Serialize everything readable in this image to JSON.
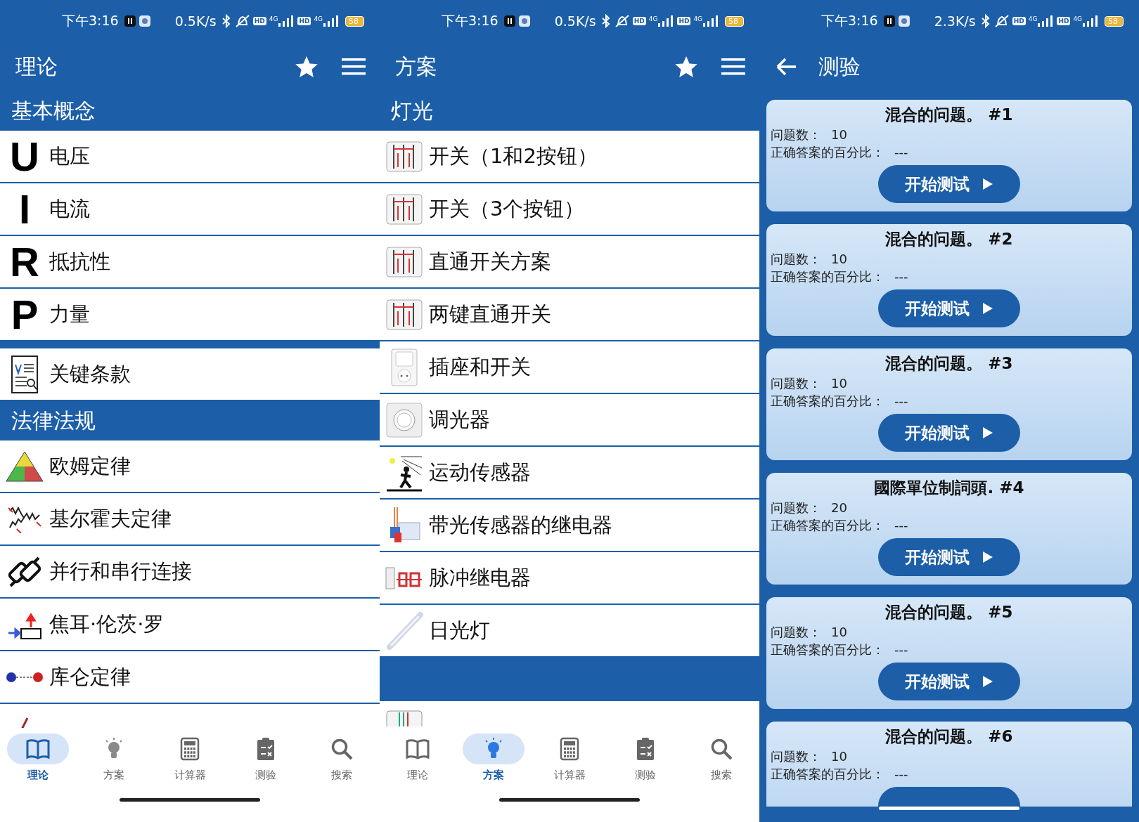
{
  "panels": [
    {
      "status_bar": {
        "time": "下午3:16",
        "speed": "0.5K/s",
        "badges": [
          "HD",
          "4G",
          "HD",
          "4G"
        ],
        "battery": "58"
      },
      "app_bar": {
        "title": "理论",
        "back": false,
        "actions": true
      },
      "sections": [
        {
          "title": "基本概念",
          "items": [
            {
              "kind": "letter",
              "symbol": "U",
              "label": "电压"
            },
            {
              "kind": "letter",
              "symbol": "I",
              "label": "电流"
            },
            {
              "kind": "letter",
              "symbol": "R",
              "label": "抵抗性"
            },
            {
              "kind": "letter",
              "symbol": "P",
              "label": "力量"
            }
          ]
        },
        {
          "items": [
            {
              "kind": "icon",
              "label": "关键条款"
            }
          ]
        },
        {
          "title": "法律法规",
          "items": [
            {
              "kind": "icon",
              "label": "欧姆定律"
            },
            {
              "kind": "icon",
              "label": "基尔霍夫定律"
            },
            {
              "kind": "icon",
              "label": "并行和串行连接"
            },
            {
              "kind": "icon",
              "label": "焦耳·伦茨·罗"
            },
            {
              "kind": "icon",
              "label": "库仑定律"
            }
          ]
        }
      ],
      "bottom_nav": [
        {
          "label": "理论",
          "selected": true
        },
        {
          "label": "方案",
          "selected": false
        },
        {
          "label": "计算器",
          "selected": false
        },
        {
          "label": "测验",
          "selected": false
        },
        {
          "label": "搜索",
          "selected": false
        }
      ]
    },
    {
      "status_bar": {
        "time": "下午3:16",
        "speed": "0.5K/s",
        "badges": [
          "HD",
          "4G",
          "HD",
          "4G"
        ],
        "battery": "58"
      },
      "app_bar": {
        "title": "方案",
        "back": false,
        "actions": true
      },
      "sections": [
        {
          "title": "灯光",
          "items": [
            {
              "kind": "icon",
              "label": "开关（1和2按钮）"
            },
            {
              "kind": "icon",
              "label": "开关（3个按钮）"
            },
            {
              "kind": "icon",
              "label": "直通开关方案"
            },
            {
              "kind": "icon",
              "label": "两键直通开关"
            },
            {
              "kind": "icon",
              "label": "插座和开关"
            },
            {
              "kind": "icon",
              "label": "调光器"
            },
            {
              "kind": "icon",
              "label": "运动传感器"
            },
            {
              "kind": "icon",
              "label": "带光传感器的继电器"
            },
            {
              "kind": "icon",
              "label": "脉冲继电器"
            },
            {
              "kind": "icon",
              "label": "日光灯"
            }
          ]
        }
      ],
      "trailing_band": true,
      "bottom_nav": [
        {
          "label": "理论",
          "selected": false
        },
        {
          "label": "方案",
          "selected": true
        },
        {
          "label": "计算器",
          "selected": false
        },
        {
          "label": "测验",
          "selected": false
        },
        {
          "label": "搜索",
          "selected": false
        }
      ]
    },
    {
      "status_bar": {
        "time": "下午3:16",
        "speed": "2.3K/s",
        "badges": [
          "HD",
          "4G",
          "HD",
          "4G"
        ],
        "battery": "58"
      },
      "app_bar": {
        "title": "测验",
        "back": true,
        "actions": false
      },
      "quizzes": [
        {
          "title": "混合的问题。 #1",
          "count_label": "问题数：",
          "count": "10",
          "percent_label": "正确答案的百分比：",
          "percent": "---",
          "button": "开始测试"
        },
        {
          "title": "混合的问题。 #2",
          "count_label": "问题数：",
          "count": "10",
          "percent_label": "正确答案的百分比：",
          "percent": "---",
          "button": "开始测试"
        },
        {
          "title": "混合的问题。 #3",
          "count_label": "问题数：",
          "count": "10",
          "percent_label": "正确答案的百分比：",
          "percent": "---",
          "button": "开始测试"
        },
        {
          "title": "國際單位制詞頭. #4",
          "count_label": "问题数：",
          "count": "20",
          "percent_label": "正确答案的百分比：",
          "percent": "---",
          "button": "开始测试"
        },
        {
          "title": "混合的问题。 #5",
          "count_label": "问题数：",
          "count": "10",
          "percent_label": "正确答案的百分比：",
          "percent": "---",
          "button": "开始测试"
        },
        {
          "title": "混合的问题。 #6",
          "count_label": "问题数：",
          "count": "10",
          "percent_label": "正确答案的百分比：",
          "percent": "---"
        }
      ]
    }
  ]
}
